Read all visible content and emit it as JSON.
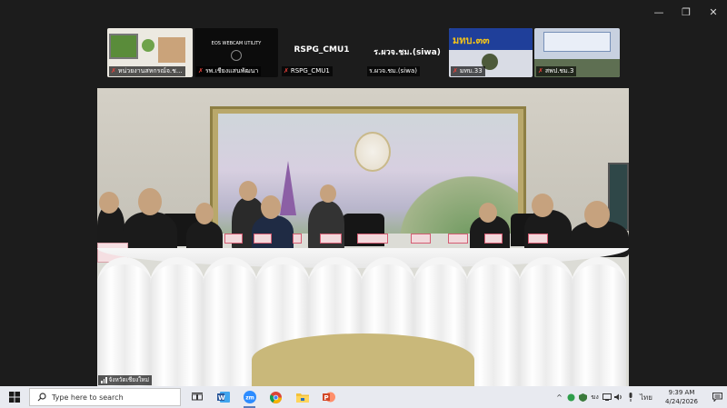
{
  "window": {
    "minimize_glyph": "—",
    "restore_glyph": "❐",
    "close_glyph": "✕"
  },
  "gallery": [
    {
      "name": "หน่วยงานสหกรณ์จ.ช...",
      "muted": true,
      "type": "video"
    },
    {
      "name": "รพ.เชียงแสนพัฒนา",
      "muted": true,
      "type": "video",
      "overlay": "EOS WEBCAM UTILITY"
    },
    {
      "name": "RSPG_CMU1",
      "muted": true,
      "type": "name-only",
      "center": "RSPG_CMU1"
    },
    {
      "name": "ร.ผวจ.ชม.(siwa)",
      "muted": false,
      "type": "name-only",
      "center": "ร.ผวจ.ชม.(siwa)"
    },
    {
      "name": "มทบ.33",
      "muted": true,
      "type": "video",
      "overlay": "มทบ.๓๓"
    },
    {
      "name": "สพป.ชม.3",
      "muted": true,
      "type": "video"
    }
  ],
  "main_video": {
    "label": "จังหวัดเชียงใหม่"
  },
  "taskbar": {
    "search_placeholder": "Type here to search",
    "time": "9:39 AM",
    "date": "4/24/2026",
    "lang": "ไทย",
    "zoom_label": "zm",
    "apps": [
      "task-view",
      "word",
      "zoom",
      "chrome",
      "file-explorer",
      "powerpoint"
    ]
  },
  "colors": {
    "background": "#1c1c1c",
    "taskbar": "#e8eaf0",
    "muted_red": "#e8413a",
    "word_blue": "#2b579a",
    "zoom_blue": "#2d8cff",
    "ppt_orange": "#d24726"
  }
}
